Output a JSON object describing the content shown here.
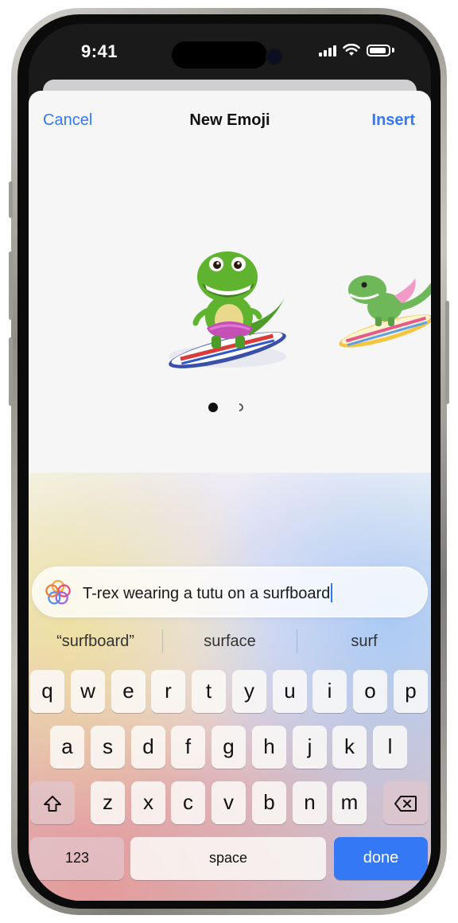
{
  "status_bar": {
    "time": "9:41"
  },
  "nav": {
    "cancel_label": "Cancel",
    "title": "New Emoji",
    "insert_label": "Insert"
  },
  "emoji_carousel": {
    "pages_count": 2,
    "active_page": 1
  },
  "prompt": {
    "text": "T-rex wearing a tutu on a surfboard",
    "icon": "apple-intelligence-icon"
  },
  "suggestions": [
    "“surfboard”",
    "surface",
    "surf"
  ],
  "keyboard": {
    "row1": [
      "q",
      "w",
      "e",
      "r",
      "t",
      "y",
      "u",
      "i",
      "o",
      "p"
    ],
    "row2": [
      "a",
      "s",
      "d",
      "f",
      "g",
      "h",
      "j",
      "k",
      "l"
    ],
    "row3": [
      "z",
      "x",
      "c",
      "v",
      "b",
      "n",
      "m"
    ],
    "numbers_label": "123",
    "space_label": "space",
    "done_label": "done",
    "shift_icon": "shift-icon",
    "delete_icon": "delete-icon",
    "mic_icon": "microphone-icon"
  },
  "colors": {
    "accent": "#3478f6",
    "sheet_bg": "#f6f6f6"
  }
}
